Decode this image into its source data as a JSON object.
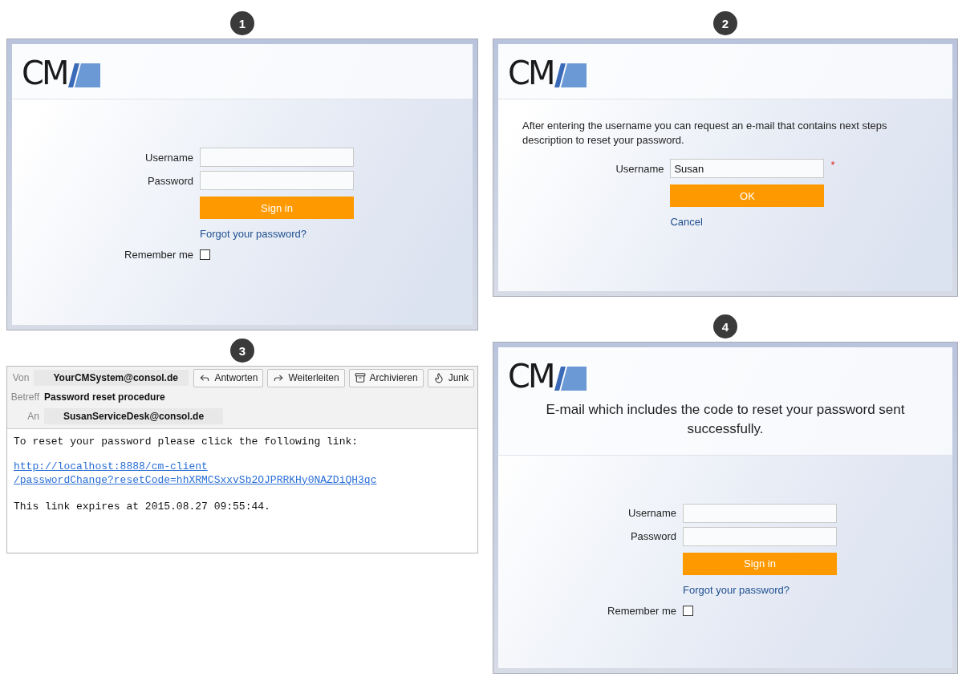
{
  "steps": [
    {
      "number": "1",
      "kind": "login",
      "logo": "CM",
      "fields": [
        {
          "label": "Username"
        },
        {
          "label": "Password"
        }
      ],
      "button": "Sign in",
      "link": "Forgot your password?",
      "remember": {
        "label": "Remember me",
        "checked": false
      }
    },
    {
      "number": "3",
      "kind": "email",
      "headers": [
        {
          "label": "Von",
          "value": "YourCMSystem@consol.de",
          "boxed": true
        },
        {
          "label": "Betreff",
          "value": "Password reset procedure",
          "boxed": false
        },
        {
          "label": "An",
          "value": "SusanServiceDesk@consol.de",
          "boxed": true
        }
      ],
      "actions": [
        {
          "kind": "reply",
          "label": "Antworten"
        },
        {
          "kind": "forward",
          "label": "Weiterleiten"
        },
        {
          "kind": "archive",
          "label": "Archivieren"
        },
        {
          "kind": "junk",
          "label": "Junk"
        }
      ],
      "intro": "To reset your password please click the following link:",
      "link_lines": [
        "http://localhost:8888/cm-client",
        "/passwordChange?resetCode=hhXRMCSxxvSb2OJPRRKHy0NAZDiQH3qc"
      ],
      "expiry": "This link expires at 2015.08.27 09:55:44."
    },
    {
      "number": "2",
      "kind": "reset_request",
      "logo": "CM",
      "message": "After entering the username you can request an e-mail that contains next steps description to reset your password.",
      "fields": [
        {
          "label": "Username",
          "value": "Susan",
          "required": true
        }
      ],
      "required_mark": "*",
      "button": "OK",
      "link": "Cancel"
    },
    {
      "number": "4",
      "kind": "login_confirmation",
      "logo": "CM",
      "message": "E-mail which includes the code to reset your password sent successfully.",
      "fields": [
        {
          "label": "Username"
        },
        {
          "label": "Password"
        }
      ],
      "button": "Sign in",
      "link": "Forgot your password?",
      "remember": {
        "label": "Remember me",
        "checked": false
      }
    }
  ]
}
